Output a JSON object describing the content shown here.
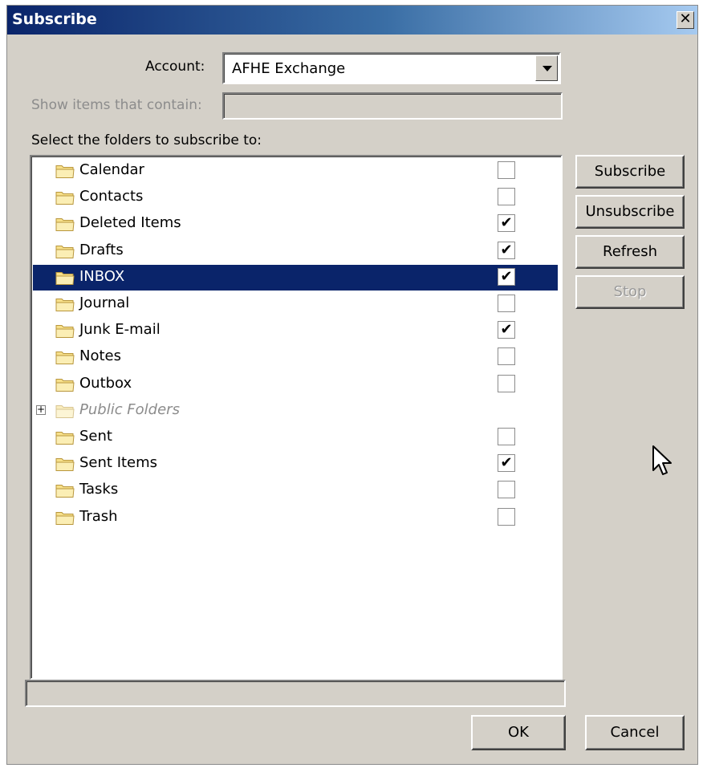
{
  "window": {
    "title": "Subscribe",
    "close_symbol": "✕"
  },
  "form": {
    "account_label": "Account:",
    "account_value": "AFHE Exchange",
    "filter_label": "Show items that contain:",
    "filter_value": "",
    "folders_label": "Select the folders to subscribe to:"
  },
  "folders": [
    {
      "name": "Calendar",
      "checked": false
    },
    {
      "name": "Contacts",
      "checked": false
    },
    {
      "name": "Deleted Items",
      "checked": true
    },
    {
      "name": "Drafts",
      "checked": true
    },
    {
      "name": "INBOX",
      "checked": true,
      "selected": true
    },
    {
      "name": "Journal",
      "checked": false
    },
    {
      "name": "Junk E-mail",
      "checked": true
    },
    {
      "name": "Notes",
      "checked": false
    },
    {
      "name": "Outbox",
      "checked": false
    },
    {
      "name": "Public Folders",
      "checked": null,
      "expandable": true,
      "expander_symbol": "+"
    },
    {
      "name": "Sent",
      "checked": false
    },
    {
      "name": "Sent Items",
      "checked": true
    },
    {
      "name": "Tasks",
      "checked": false
    },
    {
      "name": "Trash",
      "checked": false
    }
  ],
  "buttons": {
    "subscribe": "Subscribe",
    "unsubscribe": "Unsubscribe",
    "refresh": "Refresh",
    "stop": "Stop",
    "ok": "OK",
    "cancel": "Cancel"
  },
  "status": {
    "text": ""
  },
  "icons": {
    "check": "✔"
  },
  "colors": {
    "selection": "#0a246a",
    "folder_fill": "#f7e08a",
    "folder_stroke": "#b8963c"
  }
}
